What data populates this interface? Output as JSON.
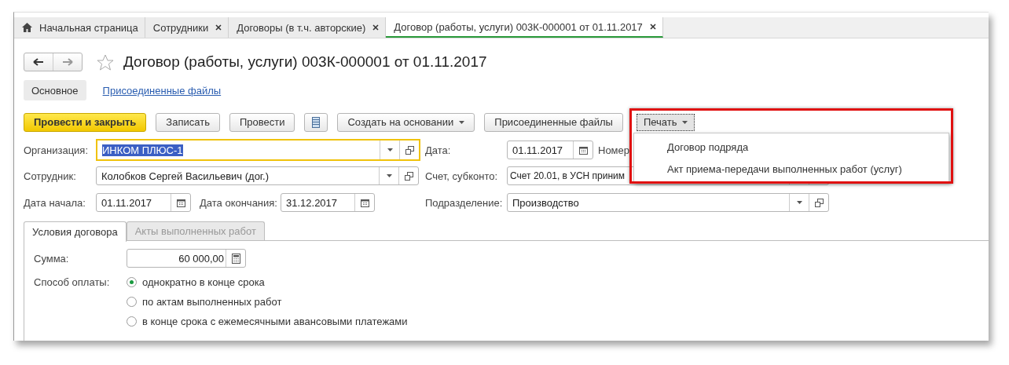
{
  "tabs": [
    {
      "label": "Начальная страница",
      "kind": "home",
      "selected": false
    },
    {
      "label": "Сотрудники",
      "kind": "closable",
      "selected": false
    },
    {
      "label": "Договоры (в т.ч. авторские)",
      "kind": "closable",
      "selected": false
    },
    {
      "label": "Договор (работы, услуги) 003К-000001 от 01.11.2017",
      "kind": "closable",
      "selected": true
    }
  ],
  "title": "Договор (работы, услуги) 003К-000001 от 01.11.2017",
  "sections": [
    {
      "label": "Основное",
      "selected": true
    },
    {
      "label": "Присоединенные файлы",
      "selected": false
    }
  ],
  "toolbar": [
    {
      "label": "Провести и закрыть",
      "kind": "primary"
    },
    {
      "label": "Записать",
      "kind": "button"
    },
    {
      "label": "Провести",
      "kind": "button"
    },
    {
      "kind": "icon"
    },
    {
      "label": "Создать на основании",
      "kind": "dropdown"
    },
    {
      "label": "Присоединенные файлы",
      "kind": "button"
    },
    {
      "label": "Печать",
      "kind": "open"
    }
  ],
  "print_menu": {
    "items": [
      "Договор подряда",
      "Акт приема-передачи выполненных работ (услуг)"
    ]
  },
  "fields": {
    "organization": {
      "label": "Организация:",
      "value": "ИНКОМ ПЛЮС-1"
    },
    "date": {
      "label": "Дата:",
      "value": "01.11.2017"
    },
    "number": {
      "label": "Номер"
    },
    "employee": {
      "label": "Сотрудник:",
      "value": "Колобков Сергей Васильевич (дог.)"
    },
    "account": {
      "label": "Счет, субконто:",
      "value": "Счет 20.01, в УСН приним"
    },
    "start": {
      "label": "Дата начала:",
      "value": "01.11.2017"
    },
    "end": {
      "label": "Дата окончания:",
      "value": "31.12.2017"
    },
    "department": {
      "label": "Подразделение:",
      "value": "Производство"
    }
  },
  "inner_tabs": [
    {
      "label": "Условия договора",
      "selected": true
    },
    {
      "label": "Акты выполненных работ",
      "selected": false
    }
  ],
  "amount": {
    "label": "Сумма:",
    "value": "60 000,00"
  },
  "payment": {
    "label": "Способ оплаты:",
    "options": [
      {
        "label": "однократно в конце срока",
        "selected": true
      },
      {
        "label": "по актам выполненных работ",
        "selected": false
      },
      {
        "label": "в конце срока с ежемесячными авансовыми платежами",
        "selected": false
      }
    ]
  }
}
